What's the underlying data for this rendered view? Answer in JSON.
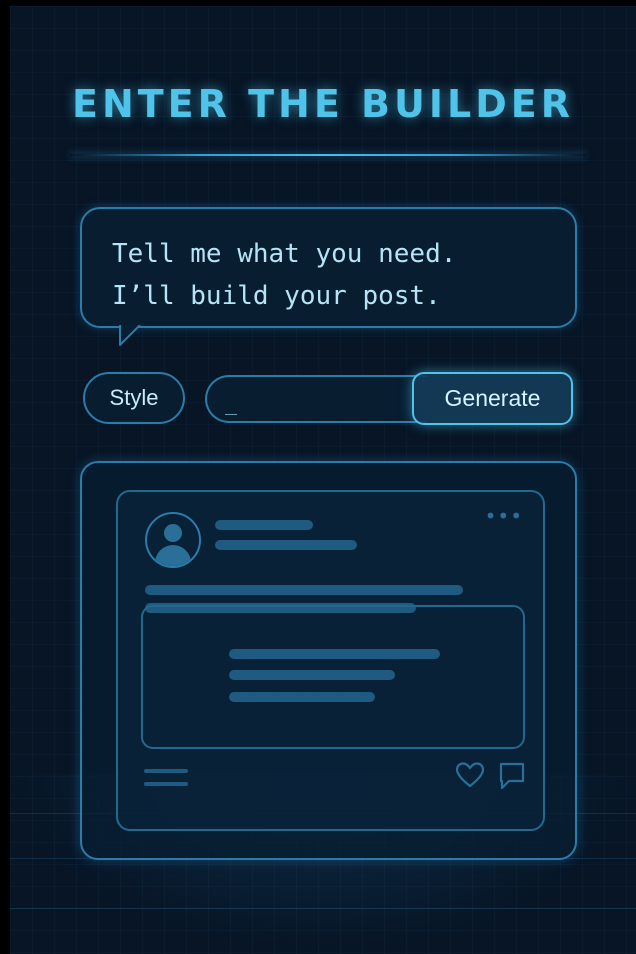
{
  "title": "ENTER THE BUILDER",
  "bubble": {
    "lines": [
      "Tell me what you need.",
      "I’ll build your post."
    ]
  },
  "controls": {
    "style_label": "Style",
    "prompt_value": "_",
    "generate_label": "Generate"
  },
  "preview": {
    "icons": [
      "avatar-icon",
      "more-dots-icon",
      "menu-icon",
      "heart-icon",
      "comment-icon"
    ],
    "more_glyph": "•••"
  },
  "colors": {
    "background": "#071525",
    "accent": "#4fc3ea",
    "border": "#2a7cab",
    "placeholder_bar": "#1f5a80"
  }
}
